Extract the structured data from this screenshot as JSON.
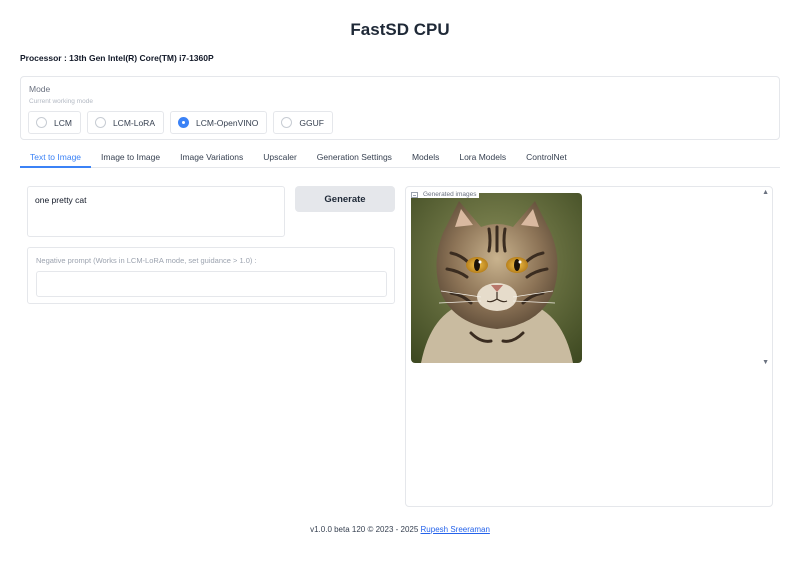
{
  "app": {
    "title": "FastSD CPU"
  },
  "processor": {
    "text": "Processor : 13th Gen Intel(R) Core(TM) i7-1360P"
  },
  "mode": {
    "label": "Mode",
    "info": "Current working mode",
    "options": [
      {
        "label": "LCM",
        "selected": false
      },
      {
        "label": "LCM-LoRA",
        "selected": false
      },
      {
        "label": "LCM-OpenVINO",
        "selected": true
      },
      {
        "label": "GGUF",
        "selected": false
      }
    ]
  },
  "tabs": [
    {
      "label": "Text to Image",
      "active": true
    },
    {
      "label": "Image to Image",
      "active": false
    },
    {
      "label": "Image Variations",
      "active": false
    },
    {
      "label": "Upscaler",
      "active": false
    },
    {
      "label": "Generation Settings",
      "active": false
    },
    {
      "label": "Models",
      "active": false
    },
    {
      "label": "Lora Models",
      "active": false
    },
    {
      "label": "ControlNet",
      "active": false
    }
  ],
  "prompt": {
    "value": "one pretty cat"
  },
  "generate": {
    "label": "Generate"
  },
  "negative_prompt": {
    "label": "Negative prompt (Works in LCM-LoRA mode, set guidance > 1.0) :",
    "value": ""
  },
  "gallery": {
    "label": "Generated images",
    "scroll_up": "▲",
    "scroll_down": "▼"
  },
  "footer": {
    "text": "v1.0.0 beta 120 © 2023 - 2025 ",
    "link": "Rupesh Sreeraman"
  },
  "colors": {
    "accent": "#3b82f6",
    "link": "#2563eb",
    "button_bg": "#e5e7eb",
    "border": "#e5e7eb"
  }
}
